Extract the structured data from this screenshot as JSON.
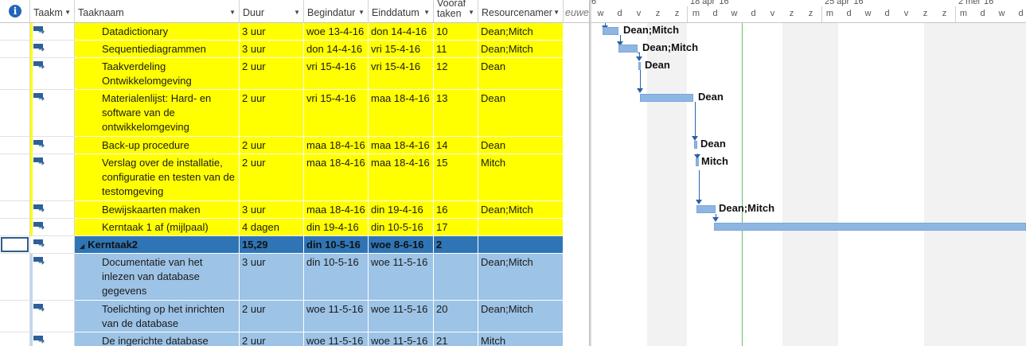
{
  "columns": {
    "taakmodus": "Taakm",
    "taaknaam": "Taaknaam",
    "duur": "Duur",
    "begindatum": "Begindatur",
    "einddatum": "Einddatum",
    "voorafgaand_line1": "Vooraf",
    "voorafgaand_line2": "taken",
    "resourcenamen": "Resourcenamer",
    "nieuwe": "euwe"
  },
  "icons": {
    "info": "info-icon",
    "task_mode": "auto-scheduled-task-icon",
    "collapse": "collapse-triangle-icon"
  },
  "rows": [
    {
      "name": "Datadictionary",
      "duur": "3 uur",
      "begin": "woe 13-4-16",
      "eind": "don 14-4-16",
      "voor": "10",
      "res": "Dean;Mitch"
    },
    {
      "name": "Sequentiediagrammen",
      "duur": "3 uur",
      "begin": "don 14-4-16",
      "eind": "vri 15-4-16",
      "voor": "11",
      "res": "Dean;Mitch"
    },
    {
      "name": "Taakverdeling Ontwikkelomgeving",
      "duur": "2 uur",
      "begin": "vri 15-4-16",
      "eind": "vri 15-4-16",
      "voor": "12",
      "res": "Dean"
    },
    {
      "name": "Materialenlijst: Hard- en software van de ontwikkelomgeving",
      "duur": "2 uur",
      "begin": "vri 15-4-16",
      "eind": "maa 18-4-16",
      "voor": "13",
      "res": "Dean"
    },
    {
      "name": "Back-up procedure",
      "duur": "2 uur",
      "begin": "maa 18-4-16",
      "eind": "maa 18-4-16",
      "voor": "14",
      "res": "Dean"
    },
    {
      "name": "Verslag over de installatie, configuratie en testen van de testomgeving",
      "duur": "2 uur",
      "begin": "maa 18-4-16",
      "eind": "maa 18-4-16",
      "voor": "15",
      "res": "Mitch"
    },
    {
      "name": "Bewijskaarten maken",
      "duur": "3 uur",
      "begin": "maa 18-4-16",
      "eind": "din 19-4-16",
      "voor": "16",
      "res": "Dean;Mitch"
    },
    {
      "name": "Kerntaak 1 af (mijlpaal)",
      "duur": "4 dagen",
      "begin": "din 19-4-16",
      "eind": "din 10-5-16",
      "voor": "17",
      "res": ""
    },
    {
      "name": "Kerntaak2",
      "duur": "15,29 dagen",
      "begin": "din 10-5-16",
      "eind": "woe 8-6-16",
      "voor": "2",
      "res": ""
    },
    {
      "name": "Documentatie van het inlezen van database gegevens",
      "duur": "3 uur",
      "begin": "din 10-5-16",
      "eind": "woe 11-5-16",
      "voor": "",
      "res": "Dean;Mitch"
    },
    {
      "name": "Toelichting op het inrichten van de database",
      "duur": "2 uur",
      "begin": "woe 11-5-16",
      "eind": "woe 11-5-16",
      "voor": "20",
      "res": "Dean;Mitch"
    },
    {
      "name": "De ingerichte database",
      "duur": "2 uur",
      "begin": "woe 11-5-16",
      "eind": "woe 11-5-16",
      "voor": "21",
      "res": "Mitch"
    }
  ],
  "timeline": {
    "weeks": [
      "6",
      "18 apr '16",
      "25 apr '16",
      "2 mei '16"
    ],
    "days": [
      "w",
      "d",
      "v",
      "z",
      "z",
      "m",
      "d",
      "w",
      "d",
      "v",
      "z",
      "z",
      "m",
      "d",
      "w",
      "d",
      "v",
      "z",
      "z",
      "m",
      "d",
      "w",
      "d"
    ]
  },
  "gantt_labels": [
    "Dean;Mitch",
    "Dean;Mitch",
    "Dean",
    "Dean",
    "Dean",
    "Mitch",
    "Dean;Mitch"
  ],
  "colors": {
    "yellow_highlight": "#ffff00",
    "light_blue": "#9dc3e6",
    "summary_blue": "#2f75b5",
    "gantt_bar": "#8fb6e3",
    "link": "#2a62a8"
  }
}
